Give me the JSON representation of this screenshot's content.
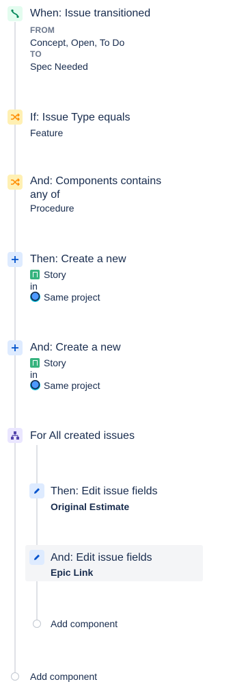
{
  "rules": [
    {
      "type": "trigger",
      "icon": "trigger-icon",
      "title": "When: Issue transitioned",
      "from_label": "FROM",
      "from_value": "Concept, Open, To Do",
      "to_label": "TO",
      "to_value": "Spec Needed"
    },
    {
      "type": "condition",
      "icon": "condition-icon",
      "title": "If: Issue Type equals",
      "detail": "Feature"
    },
    {
      "type": "condition",
      "icon": "condition-icon",
      "title_line1": "And: Components contains",
      "title_line2": "any of",
      "detail": "Procedure"
    },
    {
      "type": "action",
      "icon": "plus-icon",
      "title": "Then: Create a new",
      "issue_type": "Story",
      "in_label": "in",
      "project": "Same project"
    },
    {
      "type": "action",
      "icon": "plus-icon",
      "title": "And: Create a new",
      "issue_type": "Story",
      "in_label": "in",
      "project": "Same project"
    },
    {
      "type": "branch",
      "icon": "branch-icon",
      "title": "For All created issues",
      "children": [
        {
          "icon": "pencil-icon",
          "title": "Then: Edit issue fields",
          "detail": "Original Estimate"
        },
        {
          "icon": "pencil-icon",
          "title": "And: Edit issue fields",
          "detail": "Epic Link",
          "selected": true
        }
      ],
      "add_component": "Add component"
    }
  ],
  "add_component": "Add component",
  "colors": {
    "trigger_bg": "#e3fcef",
    "trigger_fg": "#00875a",
    "condition_bg": "#fff0b3",
    "condition_fg": "#ff8b00",
    "action_bg": "#deebff",
    "action_fg": "#0052cc",
    "branch_bg": "#eae6ff",
    "branch_fg": "#5243aa",
    "text": "#172b4d",
    "muted": "#6b778c"
  }
}
